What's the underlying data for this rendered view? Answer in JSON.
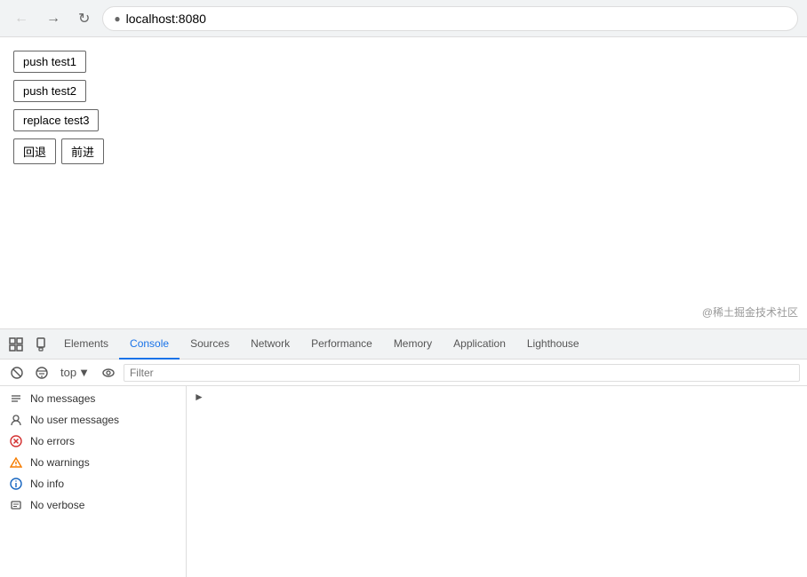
{
  "browser": {
    "url": "localhost:8080",
    "back_title": "Back",
    "forward_title": "Forward",
    "reload_title": "Reload"
  },
  "page": {
    "buttons": [
      {
        "label": "push test1"
      },
      {
        "label": "push test2"
      },
      {
        "label": "replace test3"
      }
    ],
    "nav_back": "回退",
    "nav_forward": "前进",
    "watermark": "@稀土掘金技术社区"
  },
  "devtools": {
    "tabs": [
      {
        "label": "Elements",
        "active": false
      },
      {
        "label": "Console",
        "active": true
      },
      {
        "label": "Sources",
        "active": false
      },
      {
        "label": "Network",
        "active": false
      },
      {
        "label": "Performance",
        "active": false
      },
      {
        "label": "Memory",
        "active": false
      },
      {
        "label": "Application",
        "active": false
      },
      {
        "label": "Lighthouse",
        "active": false
      }
    ],
    "console": {
      "top_label": "top",
      "filter_placeholder": "Filter",
      "sidebar_items": [
        {
          "label": "No messages",
          "icon": "≡",
          "type": "messages"
        },
        {
          "label": "No user messages",
          "icon": "👤",
          "type": "user"
        },
        {
          "label": "No errors",
          "icon": "⊗",
          "type": "error"
        },
        {
          "label": "No warnings",
          "icon": "△",
          "type": "warning"
        },
        {
          "label": "No info",
          "icon": "ℹ",
          "type": "info"
        },
        {
          "label": "No verbose",
          "icon": "✱",
          "type": "verbose"
        }
      ]
    }
  }
}
